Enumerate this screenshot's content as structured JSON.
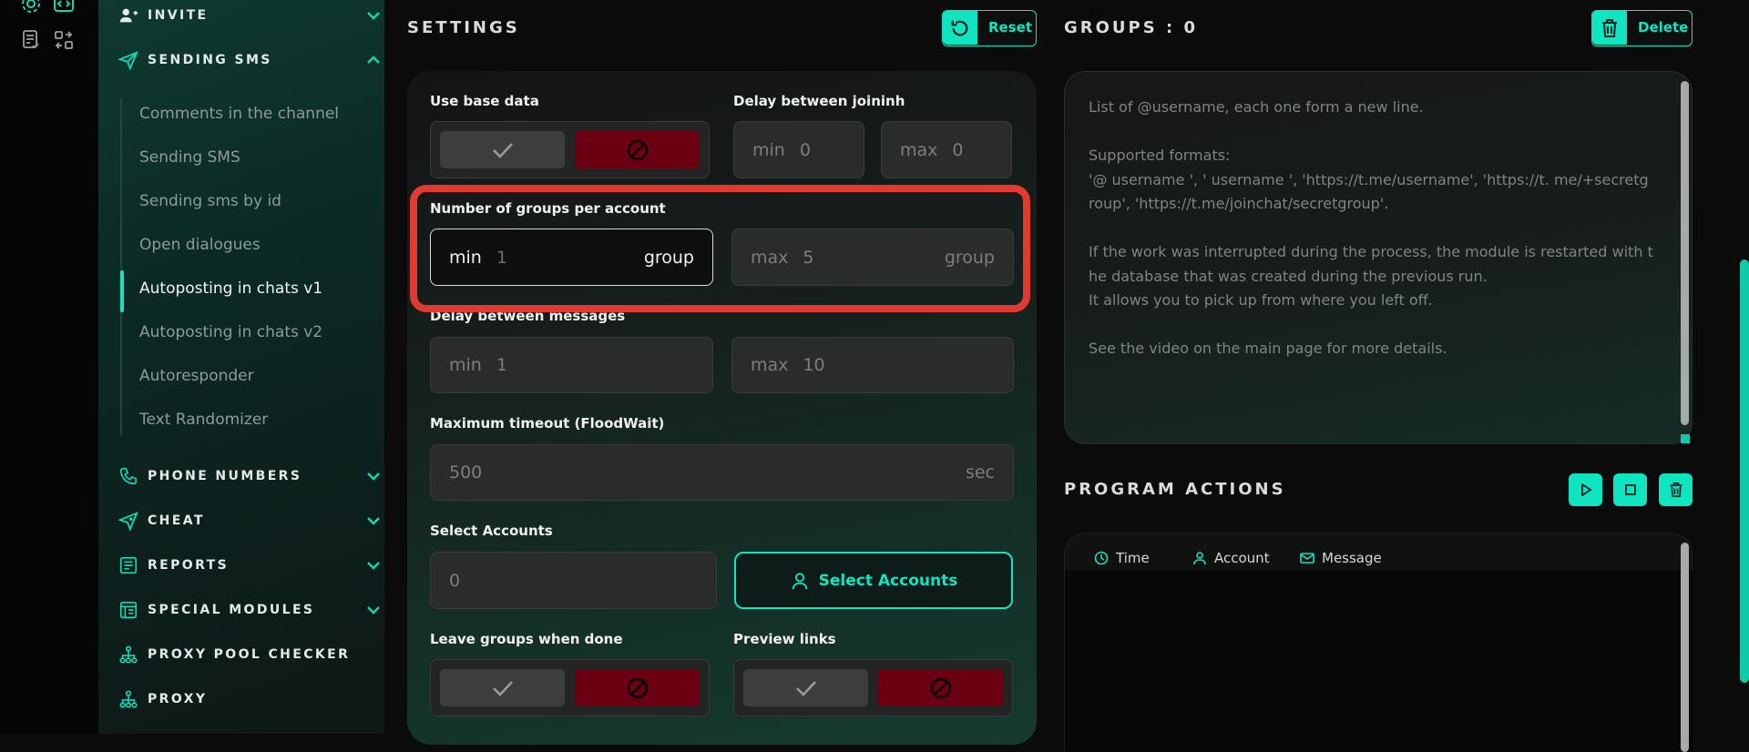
{
  "sidebar": {
    "sections": [
      {
        "label": "INVITE",
        "icon": "user-add-icon",
        "expanded": false
      },
      {
        "label": "SENDING SMS",
        "icon": "send-icon",
        "expanded": true
      },
      {
        "label": "PHONE NUMBERS",
        "icon": "phone-icon",
        "expanded": false
      },
      {
        "label": "CHEAT",
        "icon": "rocket-icon",
        "expanded": false
      },
      {
        "label": "REPORTS",
        "icon": "report-icon",
        "expanded": false
      },
      {
        "label": "SPECIAL MODULES",
        "icon": "modules-icon",
        "expanded": false
      },
      {
        "label": "PROXY POOL CHECKER",
        "icon": "network-icon"
      },
      {
        "label": "PROXY",
        "icon": "network-icon"
      }
    ],
    "sub_items": [
      "Comments in the channel",
      "Sending SMS",
      "Sending sms by id",
      "Open dialogues",
      "Autoposting in chats v1",
      "Autoposting in chats v2",
      "Autoresponder",
      "Text Randomizer"
    ],
    "active_sub": "Autoposting in chats v1"
  },
  "settings": {
    "title": "SETTINGS",
    "reset_label": "Reset",
    "use_base_data": "Use base data",
    "delay_joining": {
      "label": "Delay between joininh",
      "min_prefix": "min",
      "min_value": "0",
      "max_prefix": "max",
      "max_value": "0"
    },
    "groups_per_account": {
      "label": "Number of groups per account",
      "min_prefix": "min",
      "min_value": "1",
      "min_suffix": "group",
      "max_prefix": "max",
      "max_value": "5",
      "max_suffix": "group"
    },
    "delay_messages": {
      "label": "Delay between messages",
      "min_prefix": "min",
      "min_value": "1",
      "max_prefix": "max",
      "max_value": "10"
    },
    "timeout": {
      "label": "Maximum timeout (FloodWait)",
      "value": "500",
      "suffix": "sec"
    },
    "select_accounts": {
      "label": "Select Accounts",
      "value": "0",
      "button": "Select Accounts"
    },
    "leave_groups": "Leave groups when done",
    "preview_links": "Preview links"
  },
  "groups": {
    "title": "GROUPS : 0",
    "delete_label": "Delete",
    "placeholder": "List of @username, each one form a new line.\n\nSupported formats:\n'@ username ', ' username ', 'https://t.me/username', 'https://t. me/+secretgroup', 'https://t.me/joinchat/secretgroup'.\n\nIf the work was interrupted during the process, the module is restarted with the database that was created during the previous run.\nIt allows you to pick up from where you left off.\n\nSee the video on the main page for more details."
  },
  "program_actions": {
    "title": "PROGRAM ACTIONS",
    "columns": [
      "Time",
      "Account",
      "Message"
    ]
  },
  "colors": {
    "accent": "#0fe5c0",
    "danger": "#6a0011",
    "highlight": "#e13a31"
  }
}
